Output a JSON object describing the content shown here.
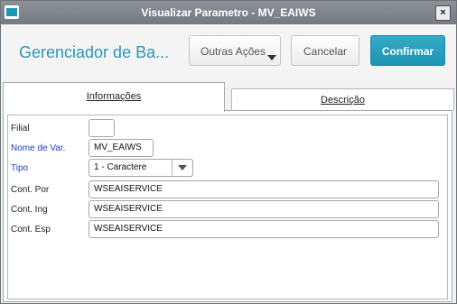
{
  "window": {
    "title": "Visualizar Parametro - MV_EAIWS",
    "close_symbol": "×"
  },
  "header": {
    "heading": "Gerenciador de Ba...",
    "more_actions": "Outras Ações",
    "cancel": "Cancelar",
    "confirm": "Confirmar"
  },
  "tabs": [
    {
      "label": "Informações",
      "selected": true
    },
    {
      "label": "Descrição",
      "selected": false
    }
  ],
  "form": {
    "filial": {
      "label": "Filial",
      "value": ""
    },
    "nome_var": {
      "label": "Nome de Var.",
      "value": "MV_EAIWS"
    },
    "tipo": {
      "label": "Tipo",
      "value": "1 - Caractere"
    },
    "cont_por": {
      "label": "Cont. Por",
      "value": "WSEAISERVICE"
    },
    "cont_ing": {
      "label": "Cont. Ing",
      "value": "WSEAISERVICE"
    },
    "cont_esp": {
      "label": "Cont. Esp",
      "value": "WSEAISERVICE"
    }
  },
  "colors": {
    "accent": "#2b97b5",
    "required_label": "#1f3fc0",
    "titlebar": "#7f858a"
  }
}
